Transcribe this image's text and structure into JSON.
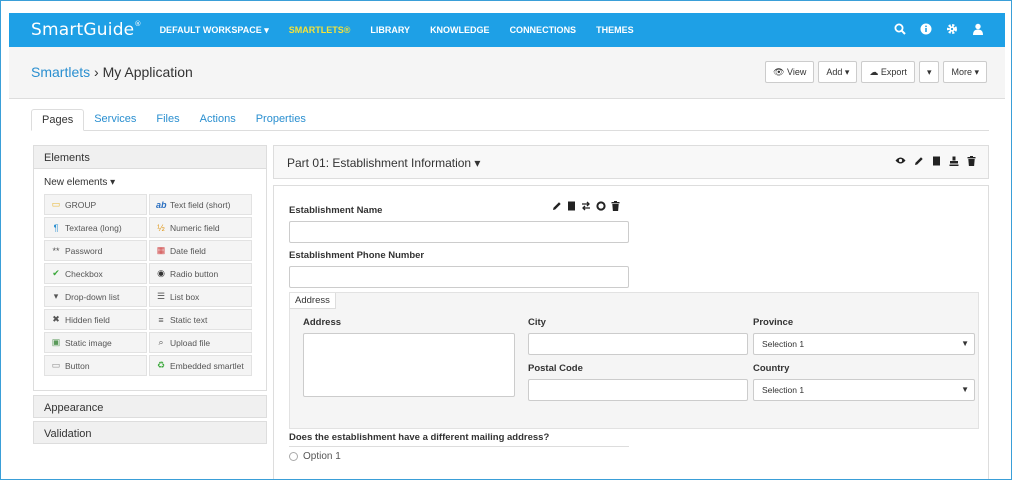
{
  "navbar": {
    "brand": "SmartGuide",
    "brand_mark": "®",
    "items": [
      {
        "label": "DEFAULT WORKSPACE ▾"
      },
      {
        "label": "SMARTLETS®"
      },
      {
        "label": "LIBRARY"
      },
      {
        "label": "KNOWLEDGE"
      },
      {
        "label": "CONNECTIONS"
      },
      {
        "label": "THEMES"
      }
    ],
    "icons": [
      "search-icon",
      "info-icon",
      "gear-icon",
      "user-icon"
    ]
  },
  "titlebar": {
    "crumb": "Smartlets",
    "separator": " › ",
    "page": "My Application",
    "buttons": {
      "view": "👁 View",
      "add": "Add ▾",
      "export": "☁ Export",
      "export_caret": "▾",
      "more": "More ▾"
    }
  },
  "tabs": [
    "Pages",
    "Services",
    "Files",
    "Actions",
    "Properties"
  ],
  "elements_panel": {
    "header": "Elements",
    "new_elements": "New elements ▾",
    "items": [
      {
        "label": "GROUP",
        "icon": "▭"
      },
      {
        "label": "Text field (short)",
        "icon": "ab"
      },
      {
        "label": "Textarea (long)",
        "icon": "¶"
      },
      {
        "label": "Numeric field",
        "icon": "½"
      },
      {
        "label": "Password",
        "icon": "**"
      },
      {
        "label": "Date field",
        "icon": "▦"
      },
      {
        "label": "Checkbox",
        "icon": "✔"
      },
      {
        "label": "Radio button",
        "icon": "◉"
      },
      {
        "label": "Drop-down list",
        "icon": "▾"
      },
      {
        "label": "List box",
        "icon": "☰"
      },
      {
        "label": "Hidden field",
        "icon": "✖"
      },
      {
        "label": "Static text",
        "icon": "≡"
      },
      {
        "label": "Static image",
        "icon": "▣"
      },
      {
        "label": "Upload file",
        "icon": "⌕"
      },
      {
        "label": "Button",
        "icon": "▭"
      },
      {
        "label": "Embedded smartlet",
        "icon": "♻"
      }
    ],
    "sections": [
      "Appearance",
      "Validation"
    ]
  },
  "page": {
    "title": "Part 01: Establishment Information ▾",
    "icons": [
      "eye-icon",
      "pencil-icon",
      "copy-icon",
      "stamp-icon",
      "trash-icon"
    ]
  },
  "form": {
    "establishment_name": "Establishment Name",
    "establishment_phone": "Establishment Phone Number",
    "field_icons": [
      "pencil-icon",
      "copy-icon",
      "swap-icon",
      "circle-icon",
      "trash-icon"
    ],
    "address": {
      "tab": "Address",
      "address_label": "Address",
      "city_label": "City",
      "province_label": "Province",
      "province_value": "Selection 1",
      "postal_label": "Postal Code",
      "country_label": "Country",
      "country_value": "Selection 1"
    },
    "question": "Does the establishment have a different mailing address?",
    "option": "Option 1"
  }
}
